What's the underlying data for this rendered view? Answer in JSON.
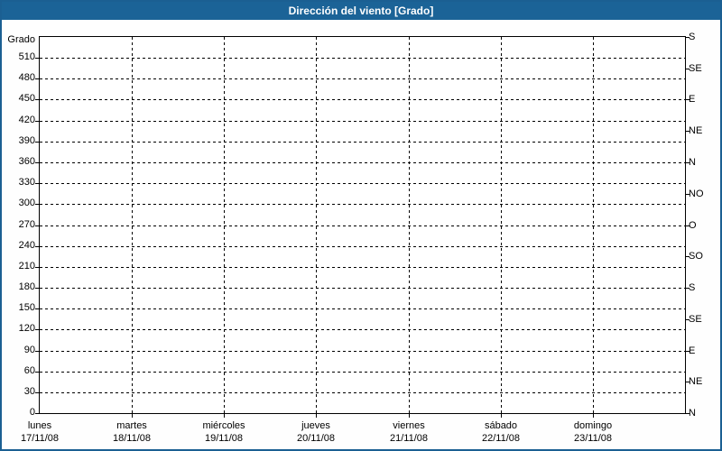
{
  "title": "Dirección del viento [Grado]",
  "colors": {
    "titlebar_bg": "#1B6397",
    "frame_border": "#1B5F92",
    "title_text": "#FFFFFF",
    "plot_bg": "#FFFFFF",
    "axis_line": "#000000",
    "grid_line": "#000000",
    "tick_text": "#000000"
  },
  "chart_data": {
    "type": "line",
    "title": "Dirección del viento [Grado]",
    "ylabel": "Grado",
    "ylim": [
      0,
      540
    ],
    "y_left_tick_step": 30,
    "y_left_ticks": [
      0,
      30,
      60,
      90,
      120,
      150,
      180,
      210,
      240,
      270,
      300,
      330,
      360,
      390,
      420,
      450,
      480,
      510
    ],
    "y_right_ticks": [
      {
        "value": 0,
        "label": "N"
      },
      {
        "value": 45,
        "label": "NE"
      },
      {
        "value": 90,
        "label": "E"
      },
      {
        "value": 135,
        "label": "SE"
      },
      {
        "value": 180,
        "label": "S"
      },
      {
        "value": 225,
        "label": "SO"
      },
      {
        "value": 270,
        "label": "O"
      },
      {
        "value": 315,
        "label": "NO"
      },
      {
        "value": 360,
        "label": "N"
      },
      {
        "value": 405,
        "label": "NE"
      },
      {
        "value": 450,
        "label": "E"
      },
      {
        "value": 495,
        "label": "SE"
      },
      {
        "value": 540,
        "label": "S"
      }
    ],
    "x_categories": [
      {
        "day": "lunes",
        "date": "17/11/08"
      },
      {
        "day": "martes",
        "date": "18/11/08"
      },
      {
        "day": "miércoles",
        "date": "19/11/08"
      },
      {
        "day": "jueves",
        "date": "20/11/08"
      },
      {
        "day": "viernes",
        "date": "21/11/08"
      },
      {
        "day": "sábado",
        "date": "22/11/08"
      },
      {
        "day": "domingo",
        "date": "23/11/08"
      }
    ],
    "series": [],
    "grid": "dashed; horizontal line every 30 degrees, vertical line at each day boundary",
    "legend": "none"
  }
}
